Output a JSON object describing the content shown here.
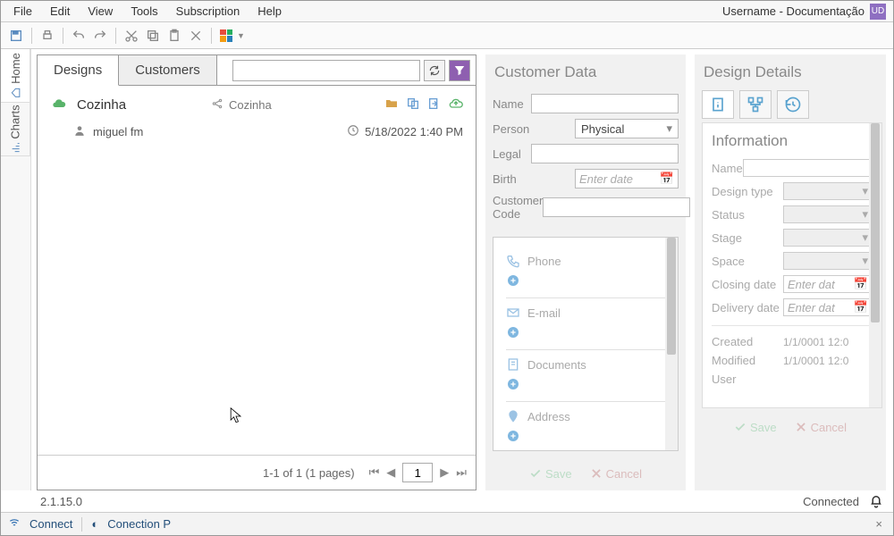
{
  "menu": {
    "file": "File",
    "edit": "Edit",
    "view": "View",
    "tools": "Tools",
    "subscription": "Subscription",
    "help": "Help"
  },
  "header": {
    "user": "Username - Documentação",
    "badge": "UD"
  },
  "lefttabs": {
    "home": "Home",
    "charts": "Charts"
  },
  "tabs": {
    "designs": "Designs",
    "customers": "Customers"
  },
  "list": {
    "project": "Cozinha",
    "shared_as": "Cozinha",
    "user": "miguel fm",
    "date": "5/18/2022 1:40 PM"
  },
  "pager": {
    "summary": "1-1 of 1 (1 pages)",
    "page": "1"
  },
  "customer": {
    "title": "Customer Data",
    "name_label": "Name",
    "person_label": "Person",
    "person_value": "Physical",
    "legal_label": "Legal",
    "birth_label": "Birth",
    "birth_placeholder": "Enter date",
    "code_label": "Customer Code",
    "phone": "Phone",
    "email": "E-mail",
    "documents": "Documents",
    "address": "Address",
    "save": "Save",
    "cancel": "Cancel"
  },
  "design": {
    "title": "Design Details",
    "info": "Information",
    "name": "Name",
    "type": "Design type",
    "status": "Status",
    "stage": "Stage",
    "space": "Space",
    "closing": "Closing date",
    "delivery": "Delivery date",
    "date_placeholder": "Enter dat",
    "created": "Created",
    "created_v": "1/1/0001 12:0",
    "modified": "Modified",
    "modified_v": "1/1/0001 12:0",
    "user": "User",
    "save": "Save",
    "cancel": "Cancel"
  },
  "status": {
    "version": "2.1.15.0",
    "connected": "Connected",
    "connect": "Connect",
    "conn_p": "Conection P"
  }
}
